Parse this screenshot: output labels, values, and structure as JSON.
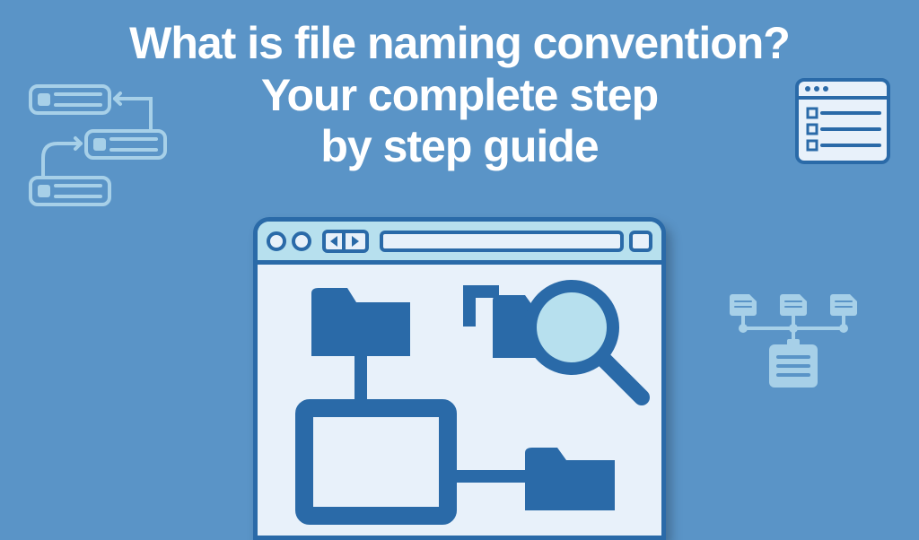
{
  "title": {
    "line1": "What is file naming convention?",
    "line2": "Your complete step",
    "line3": "by step guide"
  },
  "colors": {
    "background": "#5a94c7",
    "text": "#ffffff",
    "darkBlue": "#2a6aa8",
    "lightBlue": "#b7e0ee",
    "paleBlue": "#e8f1fa",
    "accentLight": "#a7d0e8"
  },
  "icons": {
    "flowCards": "flow-cards-icon",
    "checklistWindow": "checklist-window-icon",
    "fileTree": "file-tree-icon",
    "folder": "folder-icon",
    "magnifier": "magnifier-icon",
    "monitor": "monitor-icon"
  }
}
